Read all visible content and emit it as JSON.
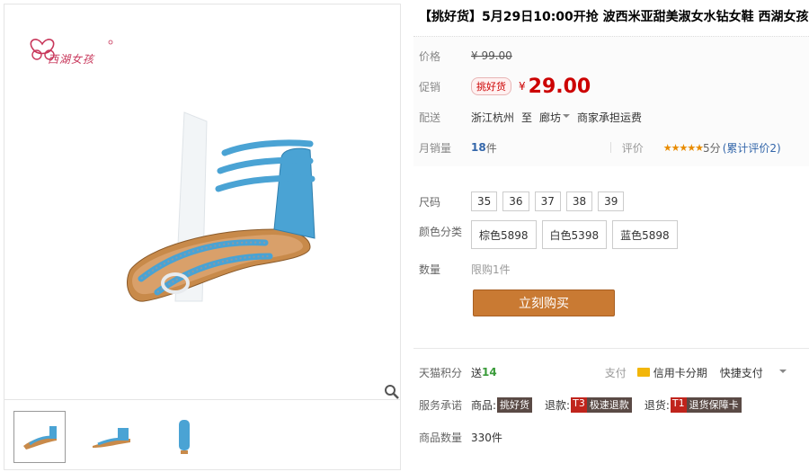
{
  "brand": {
    "logo_text": "西湖女孩"
  },
  "title": "【挑好货】5月29日10:00开抢 波西米亚甜美淑女水钻女鞋 西湖女孩",
  "price": {
    "label": "价格",
    "original": "¥ 99.00"
  },
  "promo": {
    "label": "促销",
    "badge": "挑好货",
    "currency": "¥",
    "price": "29.00"
  },
  "shipping": {
    "label": "配送",
    "from": "浙江杭州",
    "to_word": "至",
    "to": "廊坊",
    "fee": "商家承担运费"
  },
  "sales": {
    "label": "月销量",
    "count": "18",
    "unit": "件",
    "rating_label": "评价",
    "stars": "★★★★★",
    "score": "5分",
    "reviews": "(累计评价2)"
  },
  "size": {
    "label": "尺码",
    "options": [
      "35",
      "36",
      "37",
      "38",
      "39"
    ]
  },
  "color": {
    "label": "颜色分类",
    "options": [
      "棕色5898",
      "白色5398",
      "蓝色5898"
    ]
  },
  "quantity": {
    "label": "数量",
    "limit": "限购1件"
  },
  "buy_button": "立刻购买",
  "points": {
    "label": "天猫积分",
    "give": "送",
    "value": "14",
    "pay_label": "支付",
    "credit": "信用卡分期",
    "quick": "快捷支付"
  },
  "promise": {
    "label": "服务承诺",
    "items": [
      {
        "pre": "商品:",
        "code": "",
        "body": "挑好货"
      },
      {
        "pre": "退款:",
        "code": "T3",
        "body": "极速退款"
      },
      {
        "pre": "退货:",
        "code": "T1",
        "body": "退货保障卡"
      }
    ]
  },
  "stock": {
    "label": "商品数量",
    "value": "330件"
  },
  "colors": {
    "accent": "#cc0000",
    "button": "#c97a33",
    "shoe": "#4aa3d4"
  }
}
